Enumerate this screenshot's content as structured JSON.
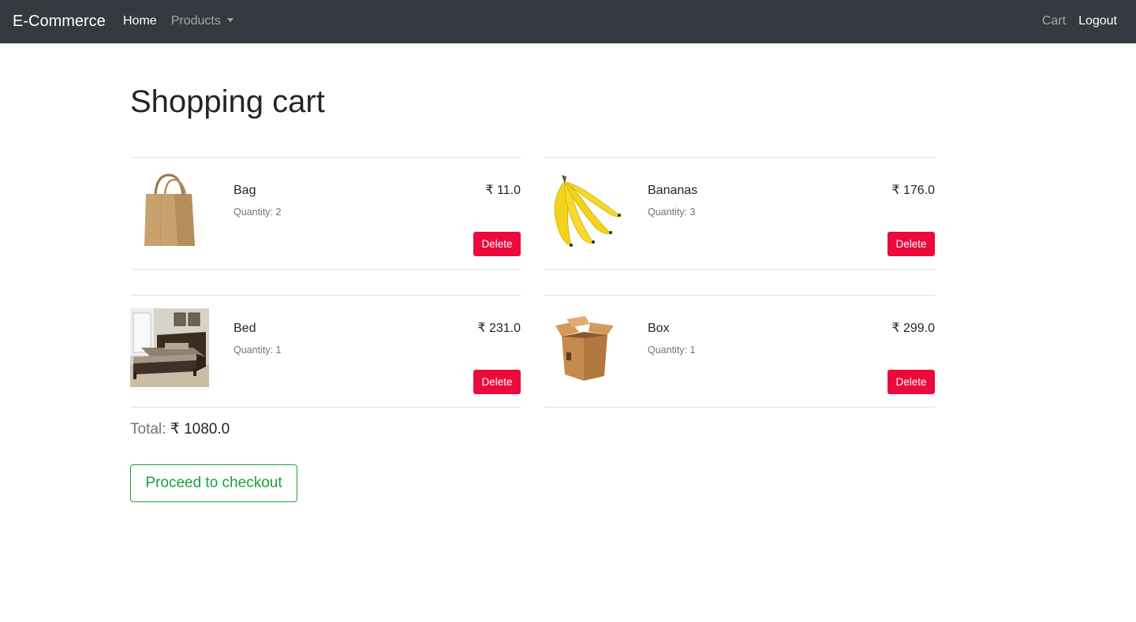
{
  "navbar": {
    "brand": "E-Commerce",
    "home_label": "Home",
    "products_label": "Products",
    "cart_label": "Cart",
    "logout_label": "Logout"
  },
  "page": {
    "title": "Shopping cart"
  },
  "cart": {
    "items": [
      {
        "name": "Bag",
        "quantity": "Quantity: 2",
        "price": "₹ 11.0",
        "delete_label": "Delete",
        "icon": "paper-bag-icon"
      },
      {
        "name": "Bananas",
        "quantity": "Quantity: 3",
        "price": "₹ 176.0",
        "delete_label": "Delete",
        "icon": "bananas-icon"
      },
      {
        "name": "Bed",
        "quantity": "Quantity: 1",
        "price": "₹ 231.0",
        "delete_label": "Delete",
        "icon": "bed-icon"
      },
      {
        "name": "Box",
        "quantity": "Quantity: 1",
        "price": "₹ 299.0",
        "delete_label": "Delete",
        "icon": "cardboard-box-icon"
      }
    ],
    "total_label": "Total:",
    "total_value": "₹ 1080.0",
    "checkout_label": "Proceed to checkout"
  },
  "colors": {
    "navbar_bg": "#343a40",
    "delete_bg": "#eb0a3a",
    "checkout_accent": "#1aa13d"
  }
}
